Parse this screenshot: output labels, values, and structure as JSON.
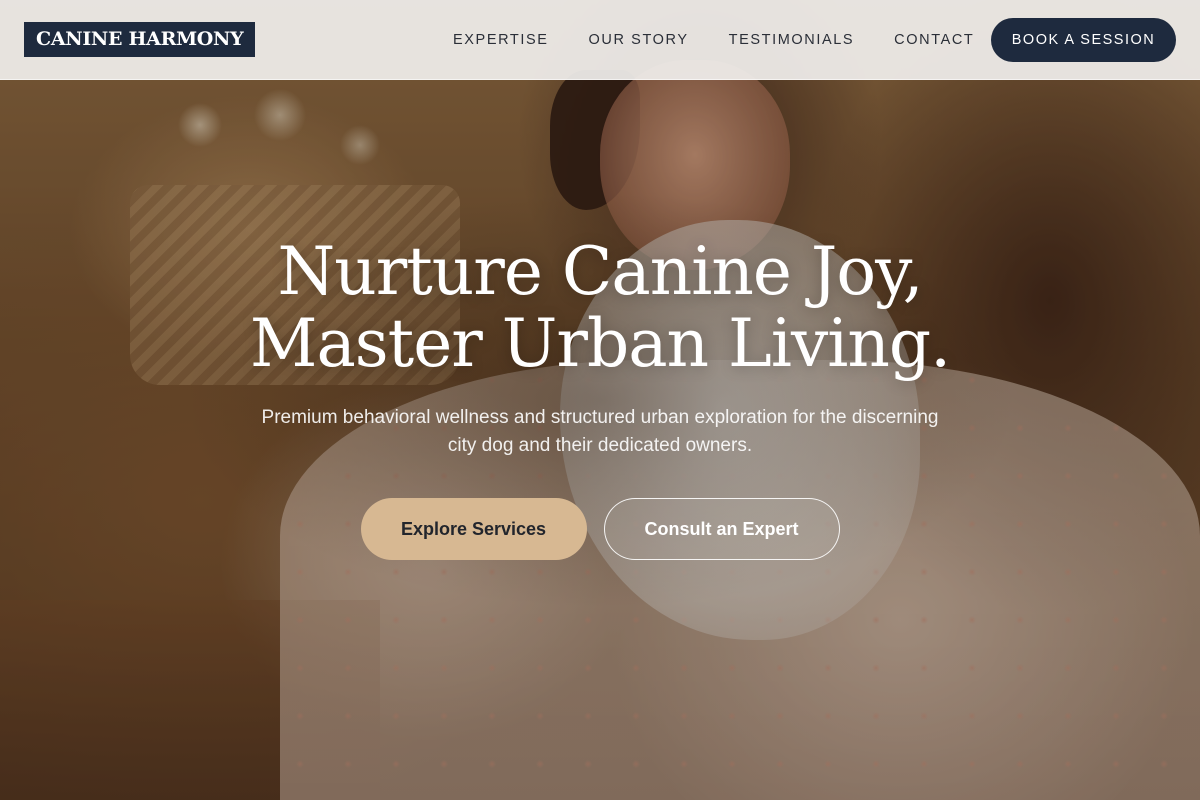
{
  "header": {
    "logo_text": "CANINE HARMONY",
    "nav": [
      {
        "label": "EXPERTISE"
      },
      {
        "label": "OUR STORY"
      },
      {
        "label": "TESTIMONIALS"
      },
      {
        "label": "CONTACT"
      }
    ],
    "cta_label": "BOOK A SESSION"
  },
  "hero": {
    "title_line1": "Nurture Canine Joy,",
    "title_line2": "Master Urban Living.",
    "subtitle": "Premium behavioral wellness and structured urban exploration for the discerning city dog and their dedicated owners.",
    "primary_button": "Explore Services",
    "secondary_button": "Consult an Expert"
  },
  "colors": {
    "navy": "#1e2a3e",
    "sand": "#d7b892",
    "header_bg": "#f0eeec"
  }
}
